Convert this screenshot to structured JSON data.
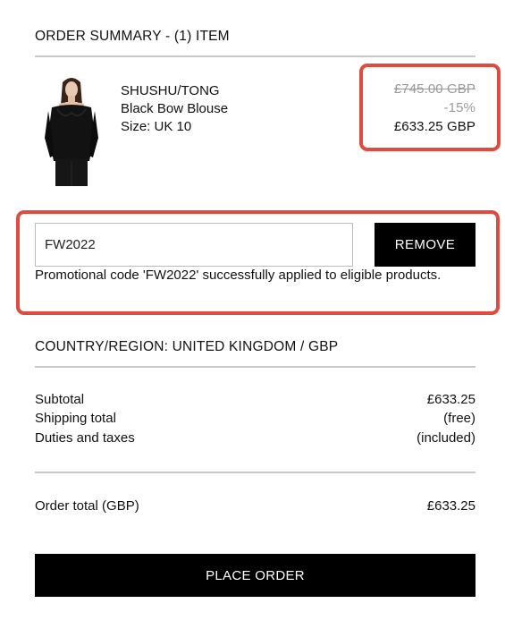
{
  "header": {
    "title": "ORDER SUMMARY - (1) ITEM"
  },
  "product": {
    "brand": "SHUSHU/TONG",
    "name": "Black Bow Blouse",
    "size": "Size: UK 10",
    "original_price": "£745.00 GBP",
    "discount": "-15%",
    "final_price": "£633.25 GBP"
  },
  "promo": {
    "code_value": "FW2022",
    "remove_label": "REMOVE",
    "message": "Promotional code 'FW2022' successfully applied to eligible products."
  },
  "region": {
    "label": "COUNTRY/REGION: UNITED KINGDOM / GBP"
  },
  "summary": {
    "subtotal_label": "Subtotal",
    "subtotal_value": "£633.25",
    "shipping_label": "Shipping total",
    "shipping_value": "(free)",
    "duties_label": "Duties and taxes",
    "duties_value": "(included)",
    "total_label": "Order total (GBP)",
    "total_value": "£633.25"
  },
  "actions": {
    "place_order_label": "PLACE ORDER"
  },
  "colors": {
    "highlight": "#e04b3f",
    "button": "#000000",
    "divider": "#c9c9c9"
  }
}
